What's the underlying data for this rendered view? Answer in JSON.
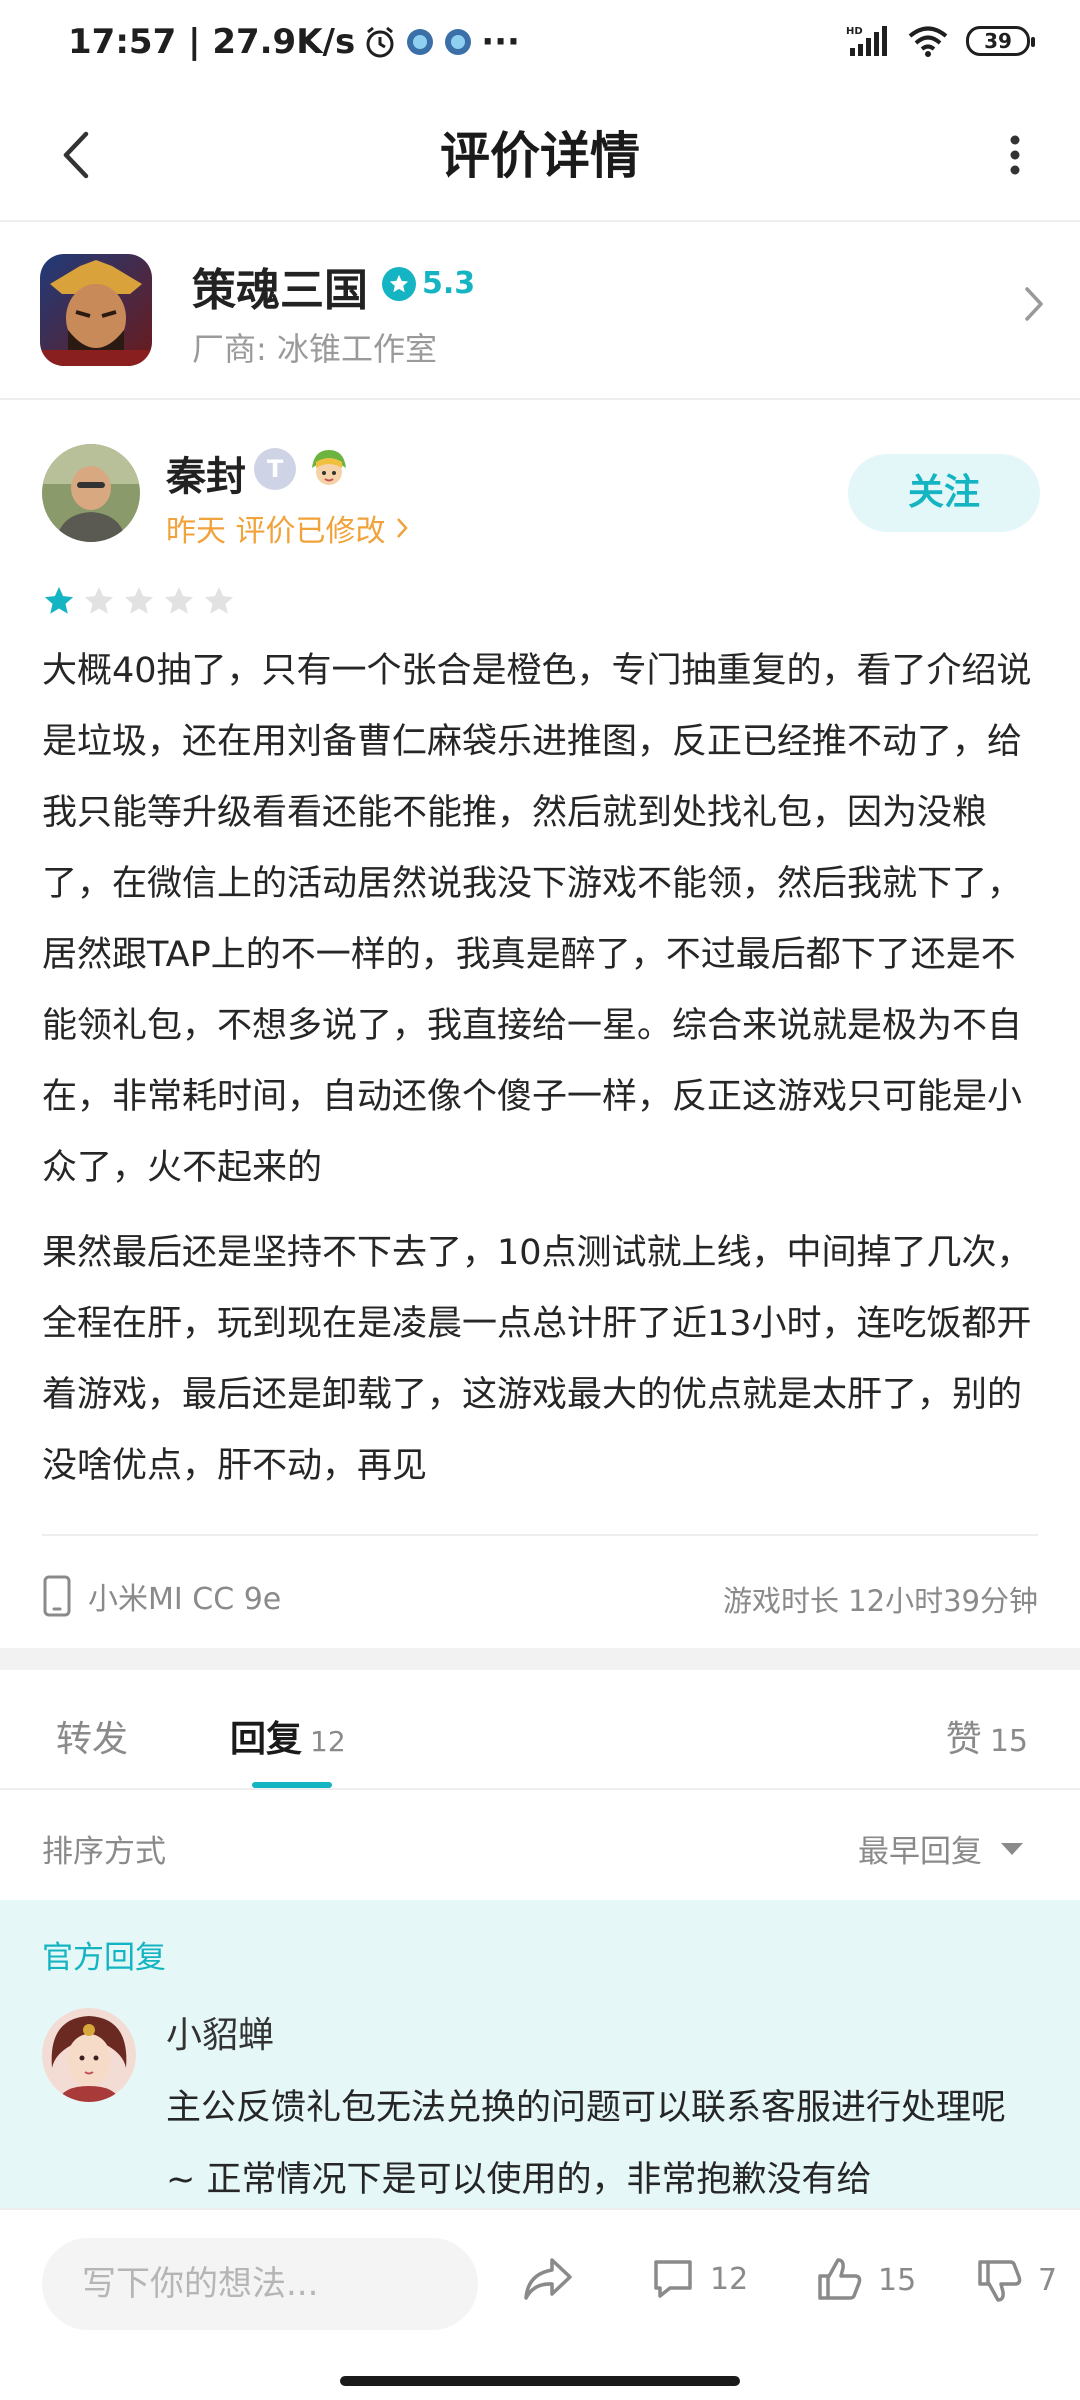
{
  "status_bar": {
    "time_speed": "17:57 | 27.9K/s",
    "more": "···",
    "network": "HD",
    "battery": "39"
  },
  "header": {
    "title": "评价详情"
  },
  "game": {
    "name": "策魂三国",
    "rating": "5.3",
    "vendor": "厂商: 冰锥工作室"
  },
  "reviewer": {
    "name": "秦封",
    "badge": "T",
    "meta": "昨天 评价已修改",
    "follow_label": "关注",
    "stars": 1,
    "stars_max": 5
  },
  "review": {
    "para1": "大概40抽了，只有一个张合是橙色，专门抽重复的，看了介绍说是垃圾，还在用刘备曹仁麻袋乐进推图，反正已经推不动了，给我只能等升级看看还能不能推，然后就到处找礼包，因为没粮了，在微信上的活动居然说我没下游戏不能领，然后我就下了，居然跟TAP上的不一样的，我真是醉了，不过最后都下了还是不能领礼包，不想多说了，我直接给一星。综合来说就是极为不自在，非常耗时间，自动还像个傻子一样，反正这游戏只可能是小众了，火不起来的",
    "para2": "果然最后还是坚持不下去了，10点测试就上线，中间掉了几次，全程在肝，玩到现在是凌晨一点总计肝了近13小时，连吃饭都开着游戏，最后还是卸载了，这游戏最大的优点就是太肝了，别的没啥优点，肝不动，再见",
    "device": "小米MI CC 9e",
    "play_time": "游戏时长 12小时39分钟"
  },
  "tabs": {
    "forward": "转发",
    "reply": "回复",
    "reply_count": "12",
    "like": "赞",
    "like_count": "15"
  },
  "sort": {
    "label": "排序方式",
    "value": "最早回复"
  },
  "official_reply": {
    "label": "官方回复",
    "name": "小貂蝉",
    "text": "主公反馈礼包无法兑换的问题可以联系客服进行处理呢 ~ 正常情况下是可以使用的，非常抱歉没有给"
  },
  "bottom_bar": {
    "input_placeholder": "写下你的想法...",
    "comment_count": "12",
    "like_count": "15",
    "dislike_count": "7"
  },
  "colors": {
    "accent": "#15b4c2",
    "meta_orange": "#f0a23b",
    "official_bg": "#e6f7f8"
  }
}
